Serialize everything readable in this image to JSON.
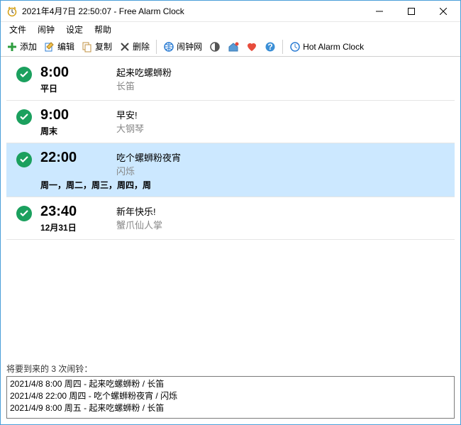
{
  "window": {
    "title": "2021年4月7日 22:50:07 - Free Alarm Clock"
  },
  "menu": {
    "file": "文件",
    "alarm": "闹钟",
    "settings": "设定",
    "help": "帮助"
  },
  "toolbar": {
    "add": "添加",
    "edit": "编辑",
    "copy": "复制",
    "delete": "删除",
    "web": "闹钟网",
    "hot": "Hot Alarm Clock"
  },
  "alarms": [
    {
      "time": "8:00",
      "recur": "平日",
      "text": "起来吃螺蛳粉",
      "sound": "长笛",
      "selected": false
    },
    {
      "time": "9:00",
      "recur": "周末",
      "text": "早安!",
      "sound": "大钢琴",
      "selected": false
    },
    {
      "time": "22:00",
      "recur": "周一，周二，周三，周四，周",
      "text": "吃个螺蛳粉夜宵",
      "sound": "闪烁",
      "selected": true,
      "wide": true
    },
    {
      "time": "23:40",
      "recur": "12月31日",
      "text": "新年快乐!",
      "sound": "蟹爪仙人掌",
      "selected": false
    }
  ],
  "upcoming": {
    "label": "将要到来的 3 次闹铃：",
    "lines": [
      "2021/4/8 8:00 周四 - 起来吃螺蛳粉 / 长笛",
      "2021/4/8 22:00 周四 - 吃个螺蛳粉夜宵 / 闪烁",
      "2021/4/9 8:00 周五 - 起来吃螺蛳粉 / 长笛"
    ]
  }
}
